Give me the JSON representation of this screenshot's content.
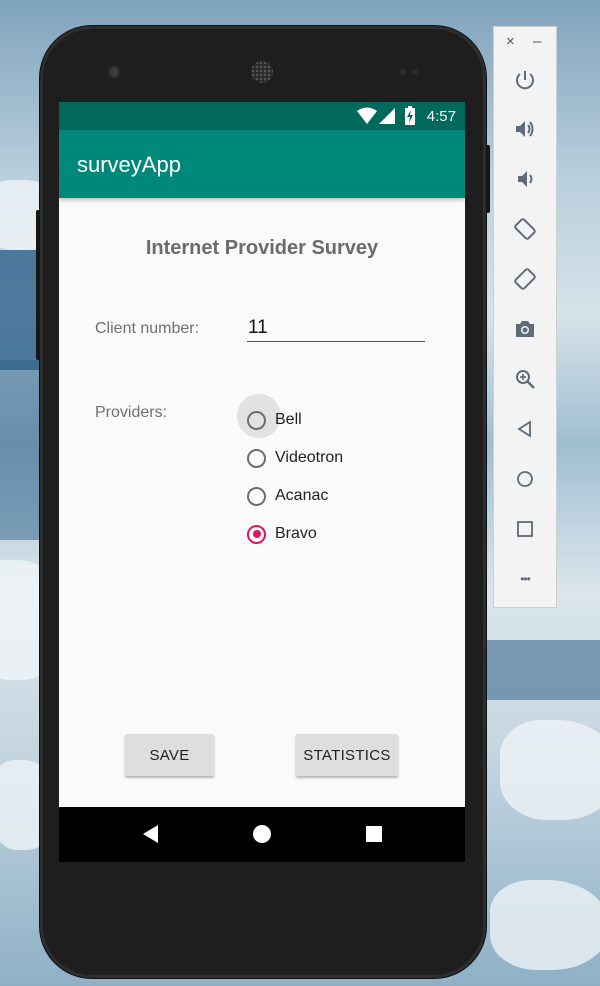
{
  "status_bar": {
    "time": "4:57"
  },
  "app_bar": {
    "title": "surveyApp"
  },
  "form": {
    "title": "Internet Provider Survey",
    "client_label": "Client number:",
    "client_value": "11",
    "providers_label": "Providers:",
    "providers": [
      {
        "label": "Bell",
        "checked": false
      },
      {
        "label": "Videotron",
        "checked": false
      },
      {
        "label": "Acanac",
        "checked": false
      },
      {
        "label": "Bravo",
        "checked": true
      }
    ]
  },
  "buttons": {
    "save": "SAVE",
    "statistics": "STATISTICS"
  },
  "emulator_toolbar": {
    "close": "×",
    "minimize": "–",
    "more": "•••",
    "icons": [
      "power-icon",
      "volume-up-icon",
      "volume-down-icon",
      "rotate-left-icon",
      "rotate-right-icon",
      "camera-icon",
      "zoom-icon",
      "back-icon",
      "home-icon",
      "overview-icon",
      "more-icon"
    ]
  },
  "colors": {
    "status_bar": "#00695c",
    "app_bar": "#00897b",
    "accent": "#e3155f"
  }
}
